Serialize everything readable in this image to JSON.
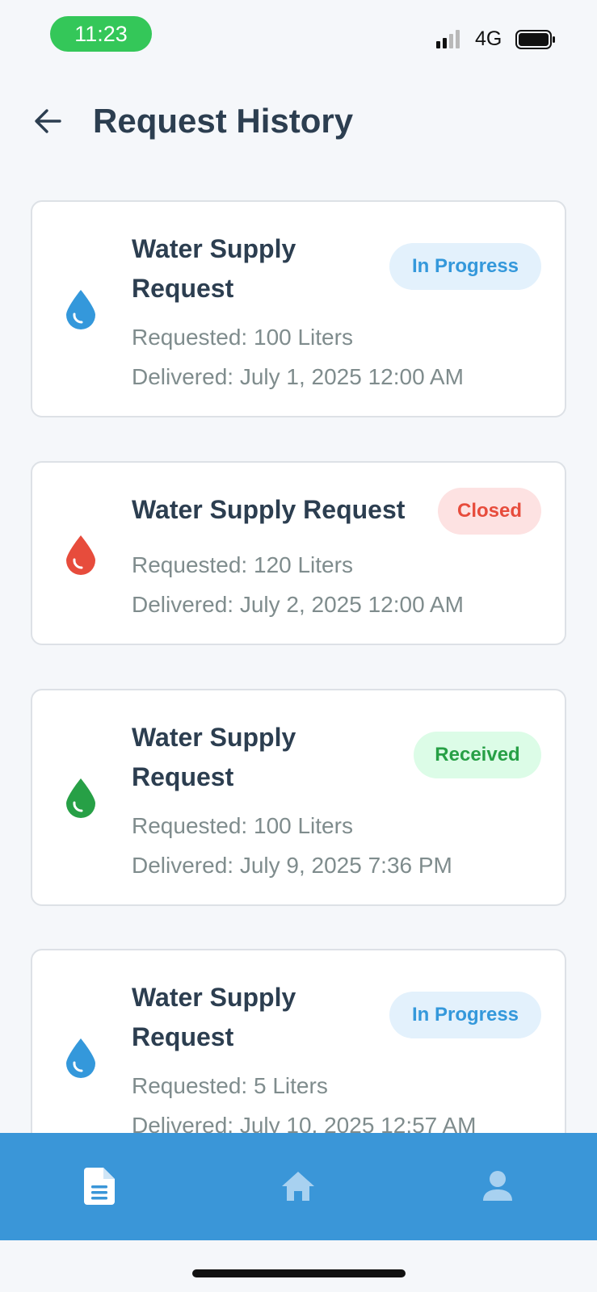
{
  "status_bar": {
    "time": "11:23",
    "network": "4G"
  },
  "header": {
    "title": "Request History"
  },
  "requests": [
    {
      "title": "Water Supply Request",
      "requested": "Requested: 100 Liters",
      "delivered": "Delivered: July 1, 2025 12:00 AM",
      "status": "In Progress",
      "drop_color": "#3498db"
    },
    {
      "title": "Water Supply Request",
      "requested": "Requested: 120 Liters",
      "delivered": "Delivered: July 2, 2025 12:00 AM",
      "status": "Closed",
      "drop_color": "#e74c3c"
    },
    {
      "title": "Water Supply Request",
      "requested": "Requested: 100 Liters",
      "delivered": "Delivered: July 9, 2025 7:36 PM",
      "status": "Received",
      "drop_color": "#27a046"
    },
    {
      "title": "Water Supply Request",
      "requested": "Requested: 5 Liters",
      "delivered": "Delivered: July 10, 2025 12:57 AM",
      "status": "In Progress",
      "drop_color": "#3498db"
    }
  ],
  "bottom_nav": {
    "items": [
      {
        "icon": "document-icon",
        "active": true
      },
      {
        "icon": "home-icon",
        "active": false
      },
      {
        "icon": "profile-icon",
        "active": false
      }
    ],
    "background": "#3a96d8"
  },
  "colors": {
    "primary": "#3498db",
    "background": "#f5f7fa"
  }
}
